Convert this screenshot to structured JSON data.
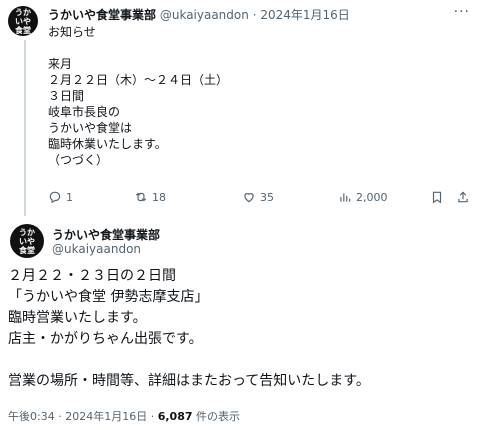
{
  "tweet1": {
    "avatar_text": "うかいや食堂",
    "name": "うかいや食堂事業部",
    "handle": "@ukaiyaandon",
    "sep": "·",
    "date": "2024年1月16日",
    "more": "···",
    "lines": [
      "お知らせ",
      "",
      "来月",
      "２月２２日（木）～２４日（土）",
      "３日間",
      "岐阜市長良の",
      "うかいや食堂は",
      "臨時休業いたします。",
      "（つづく）"
    ],
    "replies": "1",
    "retweets": "18",
    "likes": "35",
    "views": "2,000"
  },
  "tweet2": {
    "avatar_text": "うかいや食堂",
    "name": "うかいや食堂事業部",
    "handle": "@ukaiyaandon",
    "lines": [
      "２月２２・２３日の２日間",
      "「うかいや食堂 伊勢志摩支店」",
      "臨時営業いたします。",
      "店主・かがりちゃん出張です。",
      "",
      "営業の場所・時間等、詳細はまたおって告知いたします。"
    ],
    "time": "午後0:34",
    "sep": "·",
    "date": "2024年1月16日",
    "views_count": "6,087",
    "views_label": "件の表示"
  }
}
